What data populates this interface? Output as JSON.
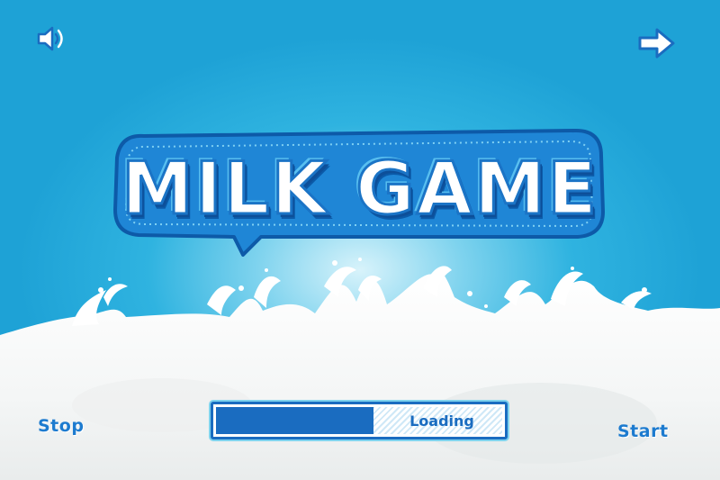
{
  "game": {
    "title": "MILK GAME"
  },
  "controls": {
    "sound_icon": "speaker-icon",
    "next_icon": "arrow-right-icon",
    "stop_label": "Stop",
    "start_label": "Start"
  },
  "loading": {
    "label": "Loading",
    "progress_percent": 55
  },
  "colors": {
    "sky": "#1ea2d6",
    "sky_glow": "#d8f3fb",
    "title_outline": "#1b74c6",
    "accent_blue": "#1a6cc0",
    "milk": "#ffffff"
  }
}
